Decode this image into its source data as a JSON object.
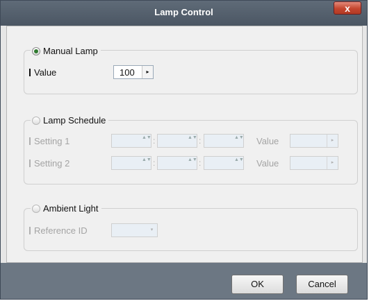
{
  "window": {
    "title": "Lamp Control",
    "close_label": "x"
  },
  "manual_lamp": {
    "label": "Manual Lamp",
    "selected": true,
    "value_label": "Value",
    "value": "100",
    "arrow": "▸"
  },
  "lamp_schedule": {
    "label": "Lamp Schedule",
    "selected": false,
    "rows": [
      {
        "label": "Setting 1",
        "value_label": "Value"
      },
      {
        "label": "Setting 2",
        "value_label": "Value"
      }
    ],
    "colon": ":",
    "stepper": "▲▼",
    "arrow": "▸"
  },
  "ambient_light": {
    "label": "Ambient Light",
    "selected": false,
    "ref_label": "Reference ID",
    "dropdown_icon": "▾"
  },
  "footer": {
    "ok_label": "OK",
    "cancel_label": "Cancel"
  },
  "colors": {
    "accent_radio": "#2f7a2f",
    "title_bar": "#56616e",
    "close_button": "#c4462f"
  }
}
